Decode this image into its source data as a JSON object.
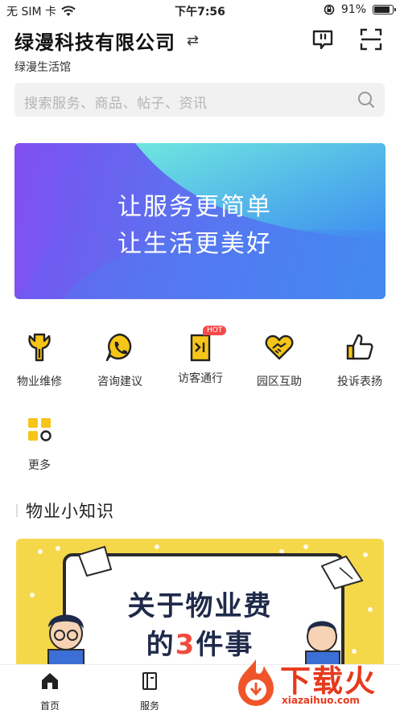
{
  "status_bar": {
    "carrier": "无 SIM 卡",
    "time": "下午7:56",
    "battery": "91%",
    "battery_level": 0.91
  },
  "header": {
    "company": "绿漫科技有限公司",
    "subtitle": "绿漫生活馆",
    "icons": [
      "swap-icon",
      "message-icon",
      "scan-icon"
    ]
  },
  "search": {
    "placeholder": "搜索服务、商品、帖子、资讯"
  },
  "banner": {
    "line1": "让服务更简单",
    "line2": "让生活更美好"
  },
  "services": [
    {
      "label": "物业维修",
      "icon": "wrench-icon"
    },
    {
      "label": "咨询建议",
      "icon": "phone-chat-icon"
    },
    {
      "label": "访客通行",
      "icon": "door-icon",
      "badge": "HOT"
    },
    {
      "label": "园区互助",
      "icon": "heart-handshake-icon"
    },
    {
      "label": "投诉表扬",
      "icon": "thumbs-up-icon"
    },
    {
      "label": "更多",
      "icon": "more-grid-icon"
    }
  ],
  "section": {
    "title": "物业小知识"
  },
  "poster": {
    "line1": "关于物业费",
    "line2_pre": "的",
    "line2_highlight": "3",
    "line2_post": "件事"
  },
  "tabbar": {
    "tabs": [
      {
        "label": "首页",
        "icon": "home-icon"
      },
      {
        "label": "服务",
        "icon": "book-icon"
      }
    ]
  },
  "watermark": {
    "text": "下载火",
    "url": "xiazaihuo.com"
  },
  "colors": {
    "accent_yellow": "#f5c518",
    "banner_start": "#7b4ff0",
    "banner_end": "#3f8ff2",
    "hot_badge": "#f4494a",
    "watermark_red": "#e63a1e"
  }
}
